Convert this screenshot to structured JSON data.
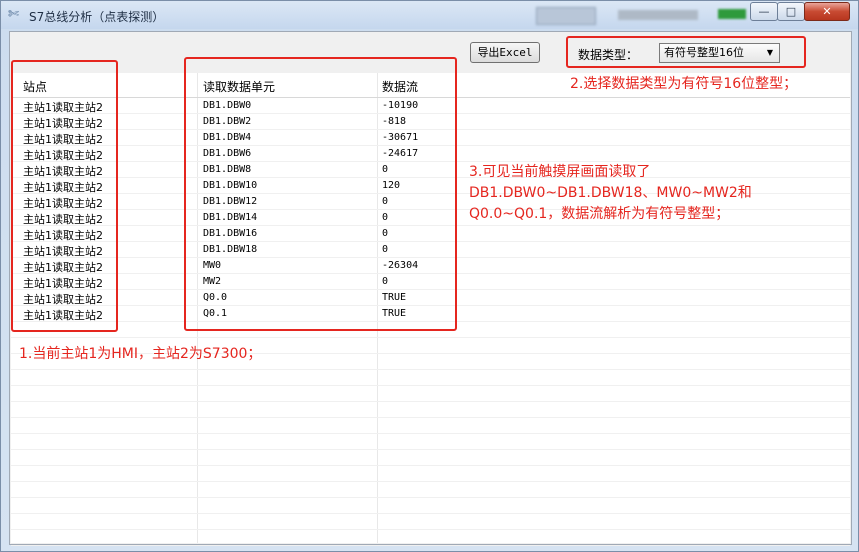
{
  "window": {
    "title": "S7总线分析（点表探测）",
    "buttons": {
      "minimize": "—",
      "maximize": "□",
      "close": "✕"
    }
  },
  "toolbar": {
    "export_label": "导出Excel",
    "type_label": "数据类型：",
    "type_selected": "有符号整型16位"
  },
  "table": {
    "headers": {
      "station": "站点",
      "unit": "读取数据单元",
      "stream": "数据流"
    },
    "rows": [
      {
        "station": "主站1读取主站2",
        "unit": "DB1.DBW0",
        "stream": "-10190"
      },
      {
        "station": "主站1读取主站2",
        "unit": "DB1.DBW2",
        "stream": "-818"
      },
      {
        "station": "主站1读取主站2",
        "unit": "DB1.DBW4",
        "stream": "-30671"
      },
      {
        "station": "主站1读取主站2",
        "unit": "DB1.DBW6",
        "stream": "-24617"
      },
      {
        "station": "主站1读取主站2",
        "unit": "DB1.DBW8",
        "stream": "0"
      },
      {
        "station": "主站1读取主站2",
        "unit": "DB1.DBW10",
        "stream": "120"
      },
      {
        "station": "主站1读取主站2",
        "unit": "DB1.DBW12",
        "stream": "0"
      },
      {
        "station": "主站1读取主站2",
        "unit": "DB1.DBW14",
        "stream": "0"
      },
      {
        "station": "主站1读取主站2",
        "unit": "DB1.DBW16",
        "stream": "0"
      },
      {
        "station": "主站1读取主站2",
        "unit": "DB1.DBW18",
        "stream": "0"
      },
      {
        "station": "主站1读取主站2",
        "unit": "MW0",
        "stream": "-26304"
      },
      {
        "station": "主站1读取主站2",
        "unit": "MW2",
        "stream": "0"
      },
      {
        "station": "主站1读取主站2",
        "unit": "Q0.0",
        "stream": "TRUE"
      },
      {
        "station": "主站1读取主站2",
        "unit": "Q0.1",
        "stream": "TRUE"
      }
    ]
  },
  "annotations": {
    "note1": "1.当前主站1为HMI，主站2为S7300；",
    "note2": "2.选择数据类型为有符号16位整型；",
    "note3_line1": "3.可见当前触摸屏画面读取了",
    "note3_line2": "DB1.DBW0~DB1.DBW18、MW0~MW2和",
    "note3_line3": "Q0.0~Q0.1，数据流解析为有符号整型；"
  },
  "colors": {
    "annotation": "#e5261f",
    "close_button": "#c84a32"
  },
  "icons": {
    "app": "tools-icon"
  }
}
